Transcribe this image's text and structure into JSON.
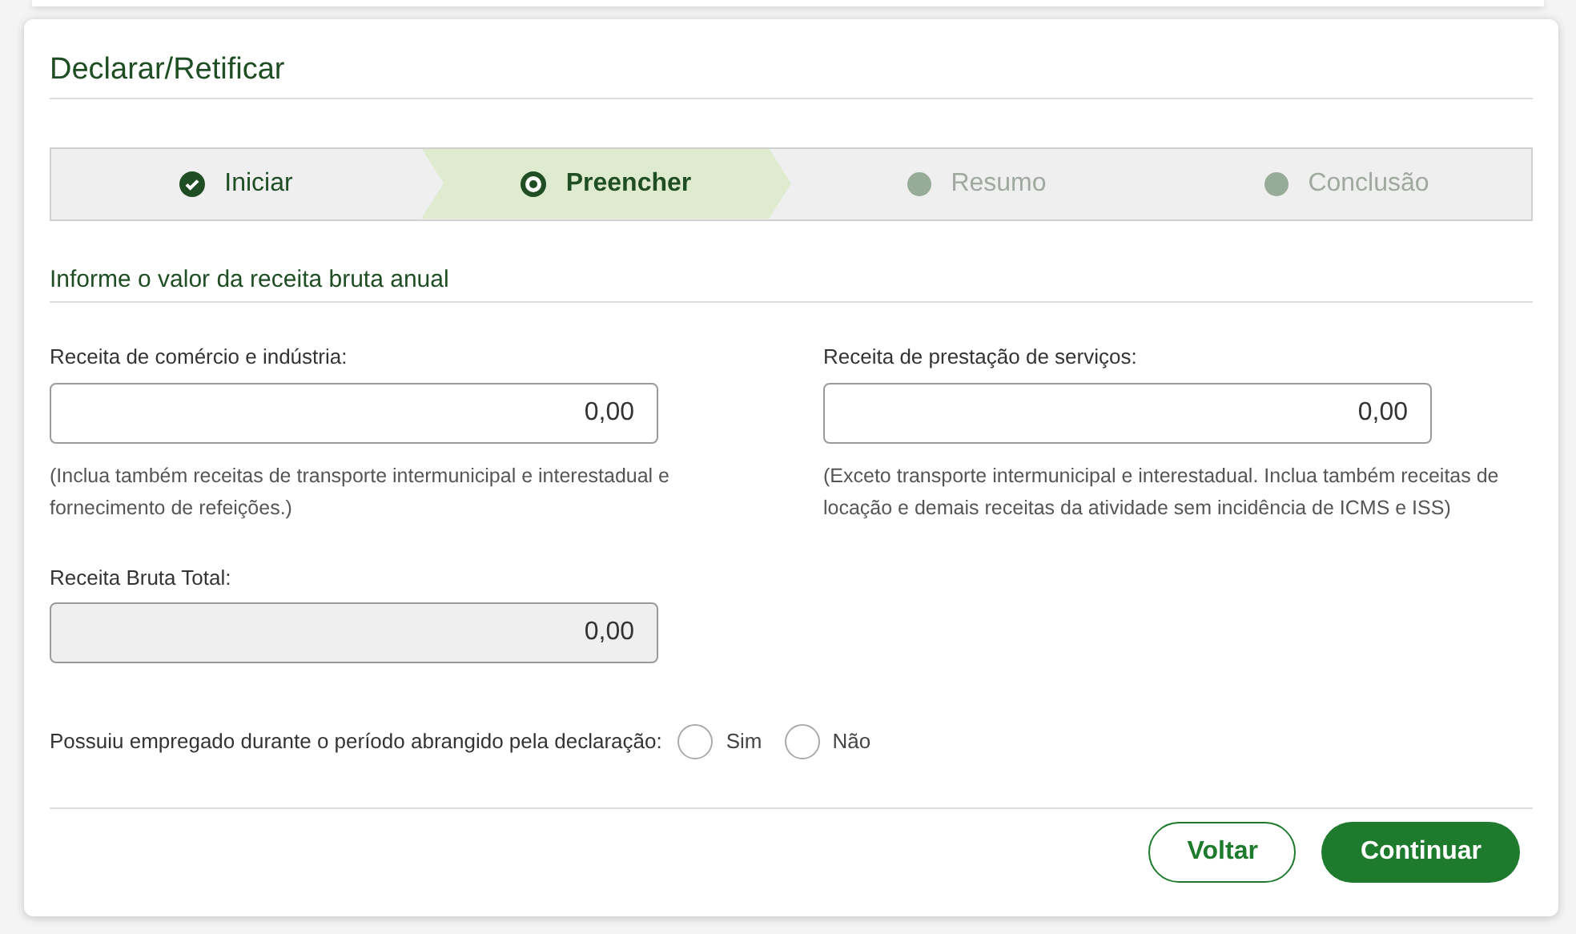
{
  "title": "Declarar/Retificar",
  "steps": [
    {
      "label": "Iniciar",
      "kind": "done",
      "selected": false
    },
    {
      "label": "Preencher",
      "kind": "current",
      "selected": true
    },
    {
      "label": "Resumo",
      "kind": "pending",
      "selected": false
    },
    {
      "label": "Conclusão",
      "kind": "pending",
      "selected": false
    }
  ],
  "section_title": "Informe o valor da receita bruta anual",
  "fields": [
    {
      "label": "Receita de comércio e indústria:",
      "value": "0,00",
      "disabled": false,
      "hint": "(Inclua também receitas de transporte intermunicipal e interestadual e fornecimento de refeições.)"
    },
    {
      "label": "Receita de prestação de serviços:",
      "value": "0,00",
      "disabled": false,
      "hint": "(Exceto transporte intermunicipal e interestadual. Inclua também receitas de locação e demais receitas da atividade sem incidência de ICMS e ISS)"
    },
    {
      "label": "Receita Bruta Total:",
      "value": "0,00",
      "disabled": true
    }
  ],
  "question": {
    "label": "Possuiu empregado durante o período abrangido pela declaração:",
    "options": [
      {
        "label": "Sim",
        "selected": false
      },
      {
        "label": "Não",
        "selected": false
      }
    ]
  },
  "buttons": [
    {
      "label": "Voltar",
      "kind": "secondary"
    },
    {
      "label": "Continuar",
      "kind": "primary"
    }
  ]
}
